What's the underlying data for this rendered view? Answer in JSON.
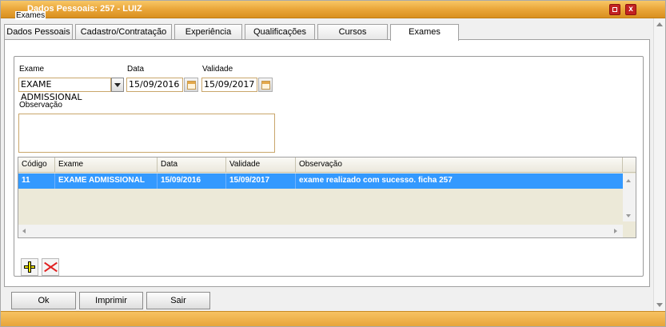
{
  "window": {
    "title": "Dados Pessoais: 257 - LUIZ",
    "maximize_glyph": "",
    "close_glyph": "x"
  },
  "tabs": [
    {
      "label": "Dados Pessoais"
    },
    {
      "label": "Cadastro/Contratação"
    },
    {
      "label": "Experiência"
    },
    {
      "label": "Qualificações"
    },
    {
      "label": "Cursos"
    },
    {
      "label": "Exames",
      "active": true
    }
  ],
  "exames_group": {
    "legend": "Exames",
    "exame_label": "Exame",
    "exame_value": "EXAME ADMISSIONAL",
    "data_label": "Data",
    "data_value": "15/09/2016",
    "validade_label": "Validade",
    "validade_value": "15/09/2017",
    "observacao_label": "Observação",
    "observacao_value": ""
  },
  "grid": {
    "columns": [
      "Código",
      "Exame",
      "Data",
      "Validade",
      "Observação"
    ],
    "rows": [
      [
        "11",
        "EXAME ADMISSIONAL",
        "15/09/2016",
        "15/09/2017",
        "exame realizado com sucesso. ficha 257"
      ]
    ]
  },
  "actions": {
    "add_icon": "plus-icon",
    "remove_icon": "delete-x-icon"
  },
  "buttons": {
    "ok": "Ok",
    "imprimir": "Imprimir",
    "sair": "Sair"
  },
  "colors": {
    "titlebar": "#eaa63a",
    "selected_row": "#3399ff",
    "field_border": "#c9a66b",
    "close_button": "#c32222"
  }
}
